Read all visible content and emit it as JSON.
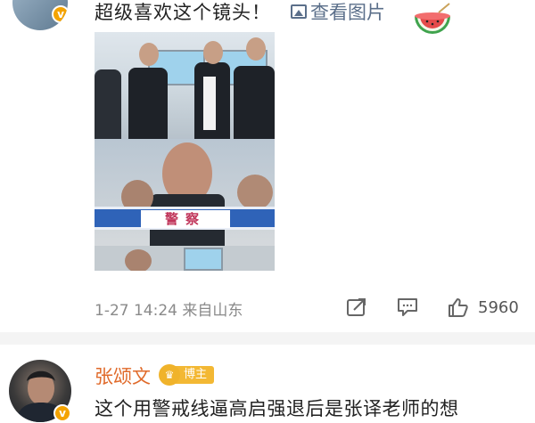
{
  "comment1": {
    "text": "超级喜欢这个镜头！",
    "view_image_label": "查看图片",
    "image_overlay_text": "警察",
    "timestamp": "1-27 14:24  来自山东",
    "like_count": "5960"
  },
  "comment2": {
    "username": "张颂文",
    "author_tag": "博主",
    "text": "这个用警戒线逼高启强退后是张译老师的想"
  },
  "colors": {
    "username": "#e06a2a",
    "link": "#5b6f8a",
    "meta": "#8a8a8a",
    "verified_badge": "#f4a300",
    "author_tag": "#f3b834"
  },
  "icons": [
    "verified-badge-icon",
    "image-icon",
    "watermelon-emoji-icon",
    "forward-icon",
    "comment-icon",
    "like-icon"
  ]
}
